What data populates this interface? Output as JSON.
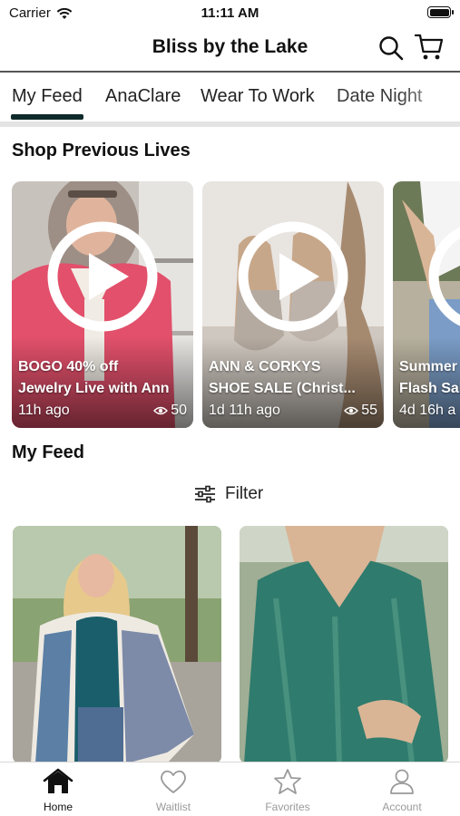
{
  "status": {
    "carrier": "Carrier",
    "time": "11:11 AM",
    "battery_level": 1.0
  },
  "header": {
    "title": "Bliss by the Lake",
    "search_icon": "search-icon",
    "cart_icon": "cart-icon"
  },
  "tabs": [
    {
      "label": "My Feed",
      "active": true
    },
    {
      "label": "AnaClare",
      "active": false
    },
    {
      "label": "Wear To Work",
      "active": false
    },
    {
      "label": "Date Night",
      "active": false
    }
  ],
  "previous_lives": {
    "title": "Shop Previous Lives",
    "items": [
      {
        "line1": "BOGO 40% off",
        "line2": "Jewelry Live with Ann",
        "ago": "11h ago",
        "views": "50"
      },
      {
        "line1": "ANN & CORKYS",
        "line2": "SHOE SALE (Christ...",
        "ago": "1d 11h ago",
        "views": "55"
      },
      {
        "line1": "Summer",
        "line2": "Flash Sal",
        "ago": "4d 16h a",
        "views": ""
      }
    ]
  },
  "feed": {
    "title": "My Feed",
    "filter_label": "Filter"
  },
  "tabbar": [
    {
      "label": "Home",
      "icon": "home-icon",
      "active": true
    },
    {
      "label": "Waitlist",
      "icon": "heart-icon",
      "active": false
    },
    {
      "label": "Favorites",
      "icon": "star-icon",
      "active": false
    },
    {
      "label": "Account",
      "icon": "person-icon",
      "active": false
    }
  ],
  "colors": {
    "accent": "#0f2a2a",
    "inactive": "#9a9a9a"
  }
}
